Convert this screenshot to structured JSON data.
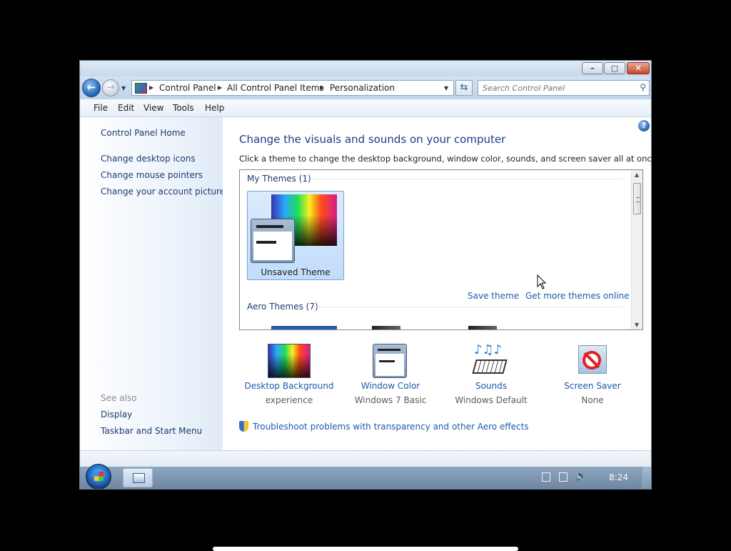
{
  "window": {
    "caption_buttons": {
      "minimize": "–",
      "maximize": "□",
      "close": "✕"
    }
  },
  "navigation": {
    "back_glyph": "←",
    "forward_glyph": "→",
    "breadcrumb": [
      "Control Panel",
      "All Control Panel Items",
      "Personalization"
    ],
    "search_placeholder": "Search Control Panel",
    "refresh_glyph": "⇆"
  },
  "menubar": {
    "items": [
      "File",
      "Edit",
      "View",
      "Tools",
      "Help"
    ]
  },
  "sidebar": {
    "home": "Control Panel Home",
    "links": [
      "Change desktop icons",
      "Change mouse pointers",
      "Change your account picture"
    ],
    "see_also_label": "See also",
    "see_also": [
      "Display",
      "Taskbar and Start Menu"
    ]
  },
  "main": {
    "help_glyph": "?",
    "heading": "Change the visuals and sounds on your computer",
    "subtext": "Click a theme to change the desktop background, window color, sounds, and screen saver all at once.",
    "theme_list": {
      "my_themes_header": "My Themes (1)",
      "selected_theme": "Unsaved Theme",
      "save_theme": "Save theme",
      "get_more": "Get more themes online",
      "aero_header": "Aero Themes (7)"
    },
    "settings": [
      {
        "label": "Desktop Background",
        "value": "experience",
        "icon": "desktop-background-icon"
      },
      {
        "label": "Window Color",
        "value": "Windows 7 Basic",
        "icon": "window-color-icon"
      },
      {
        "label": "Sounds",
        "value": "Windows Default",
        "icon": "sounds-icon"
      },
      {
        "label": "Screen Saver",
        "value": "None",
        "icon": "screen-saver-icon"
      }
    ],
    "troubleshoot": "Troubleshoot problems with transparency and other Aero effects"
  },
  "taskbar": {
    "clock": "8:24"
  },
  "colors": {
    "link": "#1e5aa8",
    "heading": "#1e3a8a",
    "close_button": "#c44a2e"
  }
}
